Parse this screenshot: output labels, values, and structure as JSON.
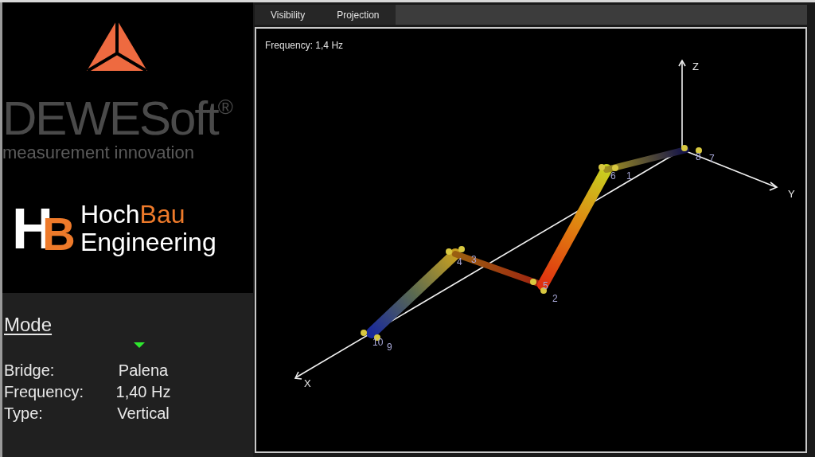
{
  "branding": {
    "company": "DEWESoft",
    "registered": "®",
    "tagline": "measurement innovation",
    "partner_mark": [
      "H",
      "B"
    ],
    "partner_name": [
      "Hoch",
      "Bau"
    ],
    "partner_subtitle": "Engineering"
  },
  "mode_panel": {
    "title": "Mode",
    "rows": [
      {
        "label": "Bridge:",
        "value": "Palena"
      },
      {
        "label": "Frequency:",
        "value": "1,40 Hz"
      },
      {
        "label": "Type:",
        "value": "Vertical"
      }
    ]
  },
  "tabs": [
    {
      "label": "Visibility",
      "selected": false
    },
    {
      "label": "Projection",
      "selected": false
    }
  ],
  "viewport": {
    "frequency_label": "Frequency: 1,4 Hz",
    "axes": [
      "X",
      "Y",
      "Z"
    ],
    "node_labels": [
      "10",
      "9",
      "4",
      "3",
      "5",
      "2",
      "6",
      "1",
      "8",
      "7"
    ]
  }
}
